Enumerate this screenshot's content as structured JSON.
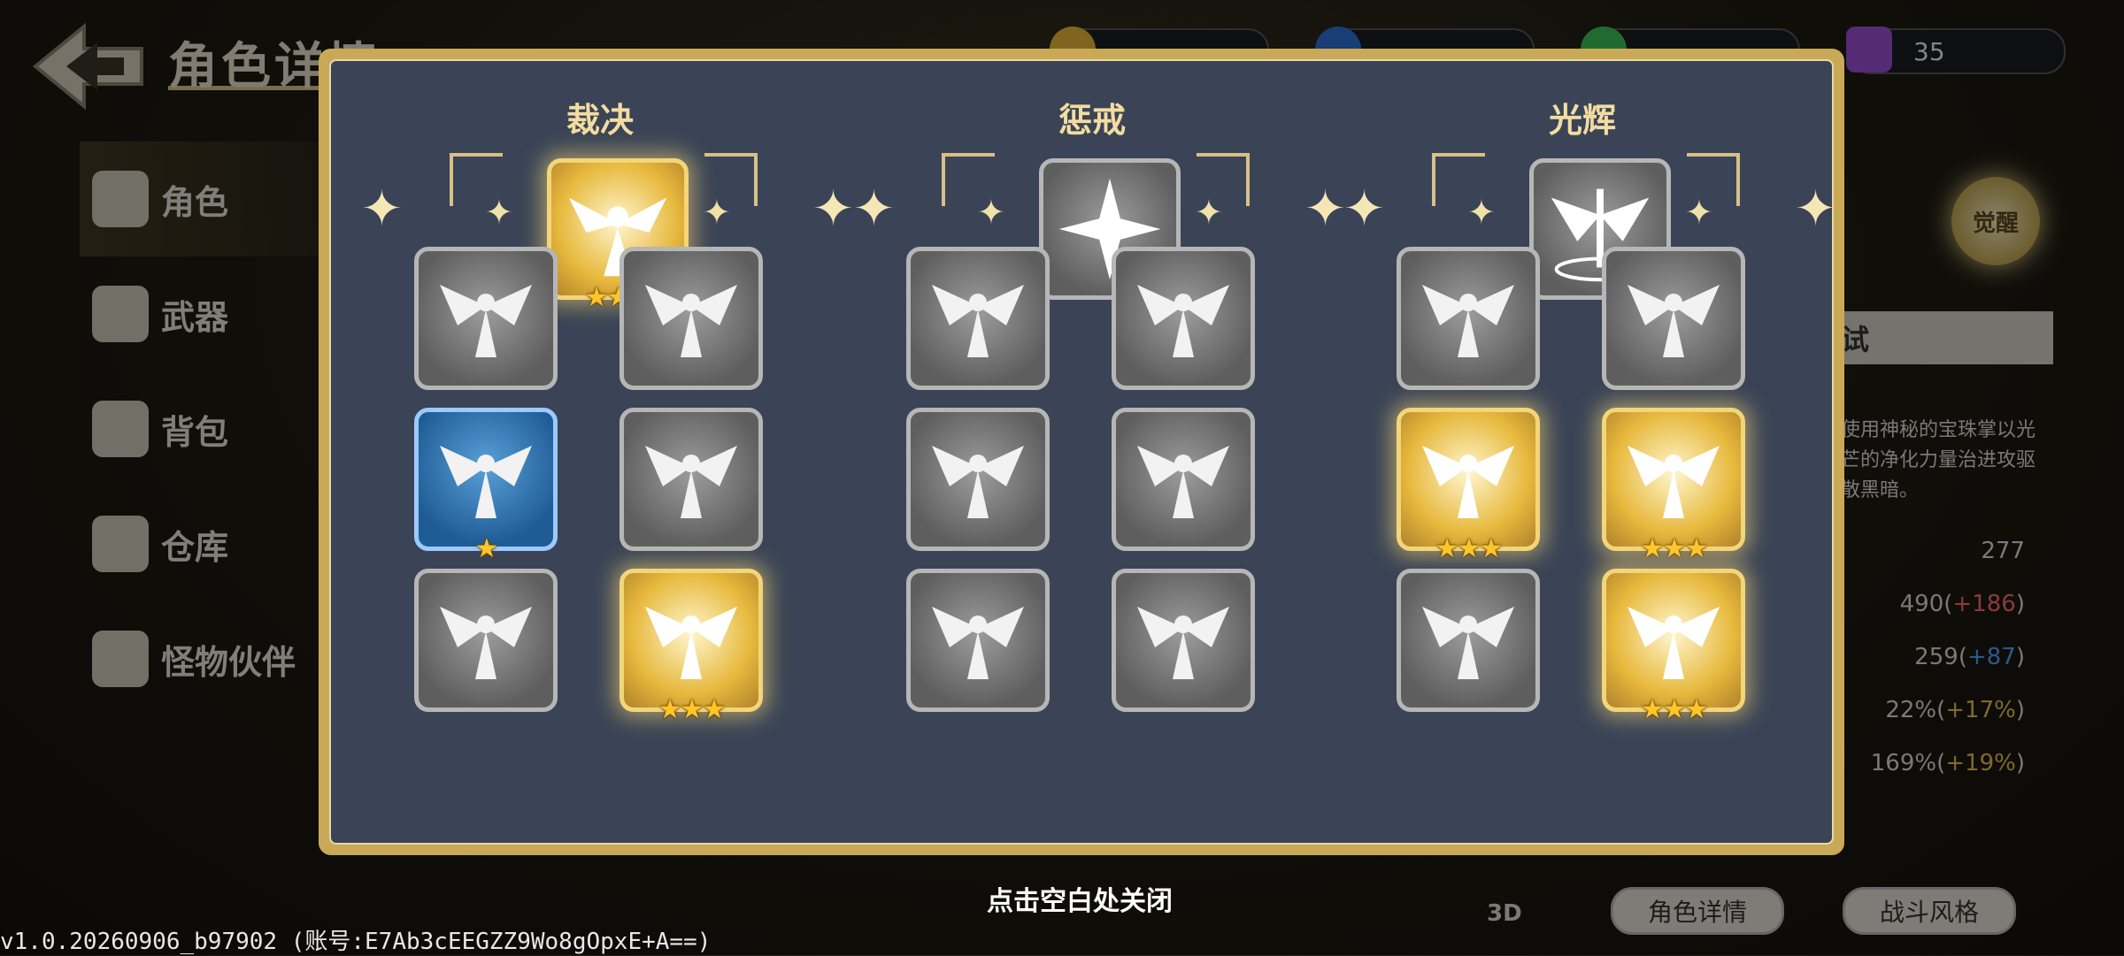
{
  "header": {
    "page_title": "角色详情",
    "currencies": [
      {
        "icon": "gold-coin-icon",
        "value": "",
        "color": "#e8b93a"
      },
      {
        "icon": "blue-gem-icon",
        "value": "",
        "color": "#2f6fd6"
      },
      {
        "icon": "green-gem-icon",
        "value": "",
        "color": "#3cc45a"
      },
      {
        "icon": "potion-icon",
        "value": "35",
        "color": "#9b4fd6"
      }
    ]
  },
  "sidebar": {
    "items": [
      {
        "label": "角色",
        "icon": "character-icon",
        "active": true
      },
      {
        "label": "武器",
        "icon": "sword-icon",
        "active": false
      },
      {
        "label": "背包",
        "icon": "backpack-icon",
        "active": false
      },
      {
        "label": "仓库",
        "icon": "chest-icon",
        "active": false
      },
      {
        "label": "怪物伙伴",
        "icon": "monster-icon",
        "active": false
      }
    ]
  },
  "right_panel": {
    "awaken_label": "觉醒",
    "style_tab_label": "试",
    "description": "使用神秘的宝珠掌以光芒的净化力量治进攻驱散黑暗。",
    "stats": [
      {
        "base": "277",
        "bonus": "",
        "bonus_color": ""
      },
      {
        "base": "490",
        "bonus": "+186",
        "bonus_color": "#ff6b6b"
      },
      {
        "base": "259",
        "bonus": "+87",
        "bonus_color": "#4da3ff"
      },
      {
        "base": "22%",
        "bonus": "+17%",
        "bonus_color": "#e9c04b"
      },
      {
        "base": "169%",
        "bonus": "+19%",
        "bonus_color": "#e9c04b"
      }
    ]
  },
  "bottom": {
    "btn_3d": "3D",
    "btn_character_detail": "角色详情",
    "btn_battle_style": "战斗风格",
    "close_hint": "点击空白处关闭",
    "version": "v1.0.20260906_b97902 (账号:E7Ab3cEEGZZ9Wo8gOpxE+A==)"
  },
  "skill_trees": [
    {
      "title": "裁决",
      "main": {
        "icon": "radiant-angel-icon",
        "style": "gold",
        "stars": 3
      },
      "skills": [
        {
          "icon": "vortex-strike-icon",
          "style": "gray",
          "stars": 0
        },
        {
          "icon": "light-beam-ring-icon",
          "style": "gray",
          "stars": 0
        },
        {
          "icon": "angel-shatter-icon",
          "style": "blue",
          "stars": 1
        },
        {
          "icon": "piercing-beams-icon",
          "style": "gray",
          "stars": 0
        },
        {
          "icon": "light-orb-swirl-icon",
          "style": "gray",
          "stars": 0
        },
        {
          "icon": "fist-buff-icon",
          "style": "gold",
          "stars": 3
        }
      ]
    },
    {
      "title": "惩戒",
      "main": {
        "icon": "four-point-star-icon",
        "style": "gray",
        "stars": 0
      },
      "skills": [
        {
          "icon": "angel-timer-icon",
          "style": "gray",
          "stars": 0
        },
        {
          "icon": "sun-burst-icon",
          "style": "gray",
          "stars": 0
        },
        {
          "icon": "sun-circle-icon",
          "style": "gray",
          "stars": 0
        },
        {
          "icon": "angel-heal-icon",
          "style": "gray",
          "stars": 0
        },
        {
          "icon": "angel-wave-icon",
          "style": "gray",
          "stars": 0
        },
        {
          "icon": "orbit-lightning-icon",
          "style": "gray",
          "stars": 0
        }
      ]
    },
    {
      "title": "光辉",
      "main": {
        "icon": "winged-staff-icon",
        "style": "gray",
        "stars": 0
      },
      "skills": [
        {
          "icon": "light-pillar-icon",
          "style": "gray",
          "stars": 0
        },
        {
          "icon": "sigil-swords-icon",
          "style": "gray",
          "stars": 0
        },
        {
          "icon": "angel-glow-icon",
          "style": "gold",
          "stars": 3
        },
        {
          "icon": "halo-angel-icon",
          "style": "gold",
          "stars": 3
        },
        {
          "icon": "star-circle-icon",
          "style": "gray",
          "stars": 0
        },
        {
          "icon": "lightning-burst-icon",
          "style": "gold",
          "stars": 3
        }
      ]
    }
  ]
}
